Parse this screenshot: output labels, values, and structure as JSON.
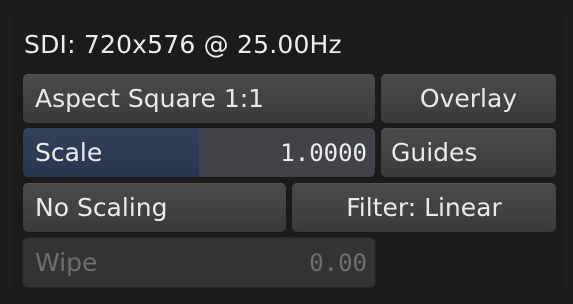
{
  "header": {
    "title": "SDI: 720x576 @ 25.00Hz"
  },
  "controls": {
    "aspect_label": "Aspect Square 1:1",
    "overlay_label": "Overlay",
    "scale": {
      "label": "Scale",
      "value": "1.0000"
    },
    "guides_label": "Guides",
    "no_scaling_label": "No Scaling",
    "filter_label": "Filter: Linear",
    "wipe": {
      "label": "Wipe",
      "value": "0.00",
      "enabled": false
    }
  },
  "colors": {
    "panel_bg": "#1b1b1b",
    "button_bg": "#444444",
    "scale_fill": "#2e3b55",
    "disabled_text": "#6e6e6e"
  }
}
